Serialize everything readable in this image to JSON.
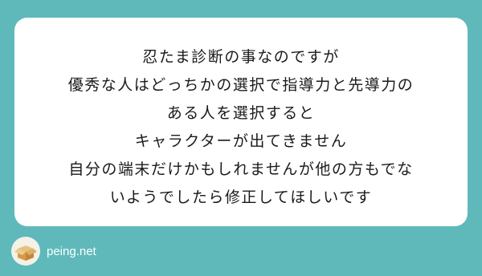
{
  "question": {
    "lines": [
      "忍たま診断の事なのですが",
      "優秀な人はどっちかの選択で指導力と先導力の",
      "ある人を選択すると",
      "キャラクターが出てきません",
      "自分の端末だけかもしれませんが他の方もでな",
      "いようでしたら修正してほしいです"
    ]
  },
  "footer": {
    "brand": "peing.net",
    "logo_icon": "cardboard-box-icon"
  },
  "colors": {
    "background": "#5fb9ba",
    "card": "#ffffff",
    "text": "#1a1a1a"
  }
}
